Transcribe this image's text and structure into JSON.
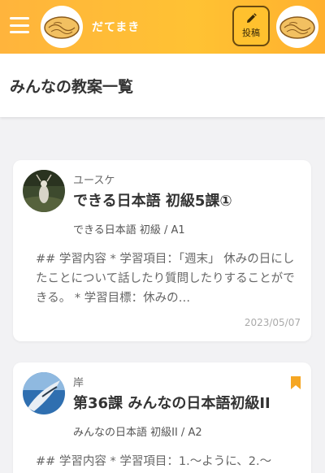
{
  "header": {
    "brand_name": "だてまき",
    "post_label": "投稿",
    "menu_icon": "hamburger-icon",
    "post_icon": "pencil-icon"
  },
  "colors": {
    "header_start": "#ffb43c",
    "header_end": "#ffb02e",
    "bookmark": "#f5a623"
  },
  "page_title": "みんなの教案一覧",
  "posts": [
    {
      "author": "ユースケ",
      "title": "できる日本語 初級5課①",
      "meta": "できる日本語 初級 /  A1",
      "excerpt": "## 学習内容 * 学習項目：「週末」 休みの日にしたことについて話したり質問したりすることができる。 * 学習目標：休みの…",
      "date": "2023/05/07"
    },
    {
      "author": "岸",
      "title": "第36課 みんなの日本語初級II",
      "meta": "みんなの日本語 初級II /  A2",
      "excerpt": "## 学習内容 * 学習項目：1.～ように、2.～"
    }
  ]
}
